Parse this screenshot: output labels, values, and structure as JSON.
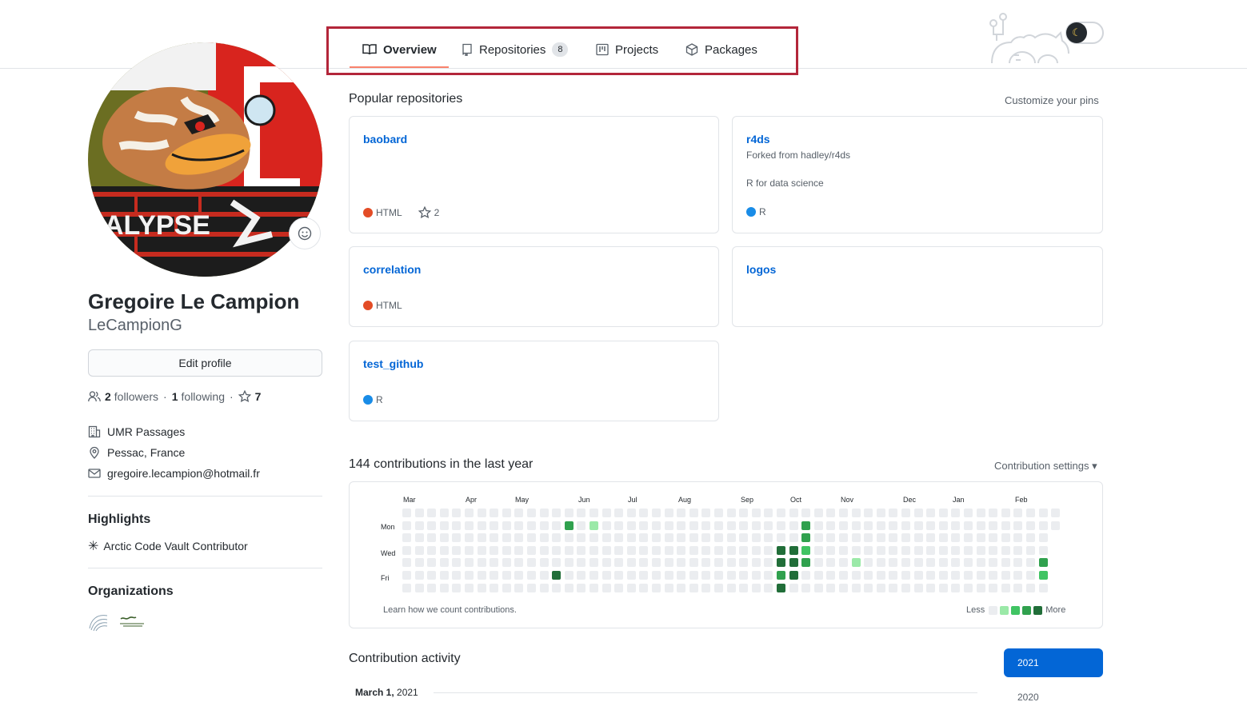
{
  "nav": {
    "tabs": [
      {
        "label": "Overview",
        "icon": "book-icon",
        "active": true
      },
      {
        "label": "Repositories",
        "icon": "repo-icon",
        "count": "8"
      },
      {
        "label": "Projects",
        "icon": "project-icon"
      },
      {
        "label": "Packages",
        "icon": "package-icon"
      }
    ]
  },
  "profile": {
    "name": "Gregoire Le Campion",
    "login": "LeCampionG",
    "edit_label": "Edit profile",
    "followers_count": "2",
    "followers_label": "followers",
    "following_count": "1",
    "following_label": "following",
    "stars_count": "7",
    "company": "UMR Passages",
    "location": "Pessac, France",
    "email": "gregoire.lecampion@hotmail.fr",
    "highlights_title": "Highlights",
    "highlight_item": "Arctic Code Vault Contributor",
    "orgs_title": "Organizations"
  },
  "popular": {
    "title": "Popular repositories",
    "customize_label": "Customize your pins",
    "repos": [
      {
        "name": "baobard",
        "lang": "HTML",
        "lang_color": "#e34c26",
        "stars": "2"
      },
      {
        "name": "r4ds",
        "forked": "Forked from hadley/r4ds",
        "description": "R for data science",
        "lang": "R",
        "lang_color": "#198ce7"
      },
      {
        "name": "correlation",
        "lang": "HTML",
        "lang_color": "#e34c26"
      },
      {
        "name": "logos"
      },
      {
        "name": "test_github",
        "lang": "R",
        "lang_color": "#198ce7"
      }
    ]
  },
  "contrib": {
    "title": "144 contributions in the last year",
    "settings_label": "Contribution settings ▾",
    "months": [
      "Mar",
      "Apr",
      "May",
      "Jun",
      "Jul",
      "Aug",
      "Sep",
      "Oct",
      "Nov",
      "Dec",
      "Jan",
      "Feb"
    ],
    "days": [
      "Mon",
      "Wed",
      "Fri"
    ],
    "learn_label": "Learn how we count contributions.",
    "less_label": "Less",
    "more_label": "More",
    "colors": [
      "#ebedf0",
      "#9be9a8",
      "#40c463",
      "#30a14e",
      "#216e39"
    ]
  },
  "activity": {
    "title": "Contribution activity",
    "date_month": "March 1,",
    "date_year": "2021",
    "years": [
      "2021",
      "2020"
    ]
  }
}
